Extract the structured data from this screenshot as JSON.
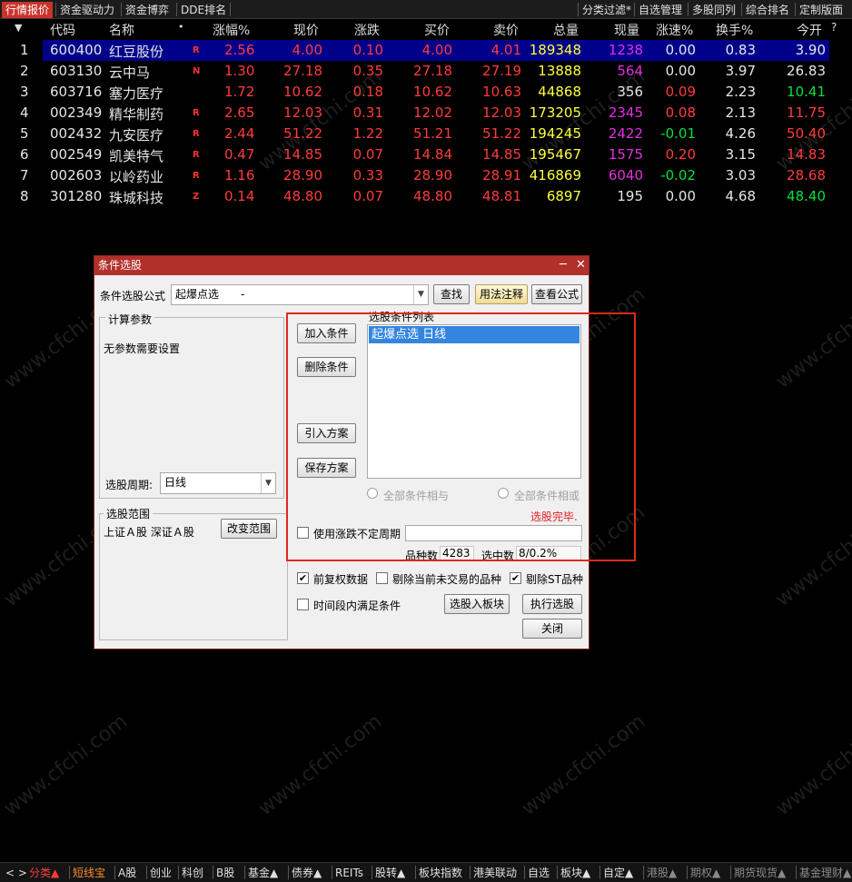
{
  "top_tabs_left": [
    "行情报价",
    "资金驱动力",
    "资金博弈",
    "DDE排名"
  ],
  "top_tabs_right": [
    "分类过滤*",
    "自选管理",
    "多股同列",
    "综合排名",
    "定制版面"
  ],
  "columns": [
    "代码",
    "名称",
    "涨幅%",
    "现价",
    "涨跌",
    "买价",
    "卖价",
    "总量",
    "现量",
    "涨速%",
    "换手%",
    "今开"
  ],
  "header_question": "?",
  "rows": [
    {
      "idx": "1",
      "code": "600400",
      "name": "红豆股份",
      "flag": "R",
      "pct": "2.56",
      "price": "4.00",
      "chg": "0.10",
      "bid": "4.00",
      "ask": "4.01",
      "vol": "189348",
      "cur": "1238",
      "speed": "0.00",
      "turn": "0.83",
      "open": "3.90"
    },
    {
      "idx": "2",
      "code": "603130",
      "name": "云中马",
      "flag": "N",
      "pct": "1.30",
      "price": "27.18",
      "chg": "0.35",
      "bid": "27.18",
      "ask": "27.19",
      "vol": "13888",
      "cur": "564",
      "speed": "0.00",
      "turn": "3.97",
      "open": "26.83"
    },
    {
      "idx": "3",
      "code": "603716",
      "name": "塞力医疗",
      "flag": "",
      "pct": "1.72",
      "price": "10.62",
      "chg": "0.18",
      "bid": "10.62",
      "ask": "10.63",
      "vol": "44868",
      "cur": "356",
      "speed": "0.09",
      "turn": "2.23",
      "open": "10.41"
    },
    {
      "idx": "4",
      "code": "002349",
      "name": "精华制药",
      "flag": "R",
      "pct": "2.65",
      "price": "12.03",
      "chg": "0.31",
      "bid": "12.02",
      "ask": "12.03",
      "vol": "173205",
      "cur": "2345",
      "speed": "0.08",
      "turn": "2.13",
      "open": "11.75"
    },
    {
      "idx": "5",
      "code": "002432",
      "name": "九安医疗",
      "flag": "R",
      "pct": "2.44",
      "price": "51.22",
      "chg": "1.22",
      "bid": "51.21",
      "ask": "51.22",
      "vol": "194245",
      "cur": "2422",
      "speed": "-0.01",
      "turn": "4.26",
      "open": "50.40"
    },
    {
      "idx": "6",
      "code": "002549",
      "name": "凯美特气",
      "flag": "R",
      "pct": "0.47",
      "price": "14.85",
      "chg": "0.07",
      "bid": "14.84",
      "ask": "14.85",
      "vol": "195467",
      "cur": "1575",
      "speed": "0.20",
      "turn": "3.15",
      "open": "14.83"
    },
    {
      "idx": "7",
      "code": "002603",
      "name": "以岭药业",
      "flag": "R",
      "pct": "1.16",
      "price": "28.90",
      "chg": "0.33",
      "bid": "28.90",
      "ask": "28.91",
      "vol": "416869",
      "cur": "6040",
      "speed": "-0.02",
      "turn": "3.03",
      "open": "28.68"
    },
    {
      "idx": "8",
      "code": "301280",
      "name": "珠城科技",
      "flag": "Z",
      "pct": "0.14",
      "price": "48.80",
      "chg": "0.07",
      "bid": "48.80",
      "ask": "48.81",
      "vol": "6897",
      "cur": "195",
      "speed": "0.00",
      "turn": "4.68",
      "open": "48.40"
    }
  ],
  "row_colors": [
    {
      "pct": "r",
      "price": "r",
      "chg": "r",
      "bid": "r",
      "ask": "r",
      "cur": "m",
      "speed": "w",
      "open": "w"
    },
    {
      "pct": "r",
      "price": "r",
      "chg": "r",
      "bid": "r",
      "ask": "r",
      "cur": "m",
      "speed": "w",
      "open": "w"
    },
    {
      "pct": "r",
      "price": "r",
      "chg": "r",
      "bid": "r",
      "ask": "r",
      "cur": "w",
      "speed": "r",
      "open": "g"
    },
    {
      "pct": "r",
      "price": "r",
      "chg": "r",
      "bid": "r",
      "ask": "r",
      "cur": "m",
      "speed": "r",
      "open": "r"
    },
    {
      "pct": "r",
      "price": "r",
      "chg": "r",
      "bid": "r",
      "ask": "r",
      "cur": "m",
      "speed": "g",
      "open": "r"
    },
    {
      "pct": "r",
      "price": "r",
      "chg": "r",
      "bid": "r",
      "ask": "r",
      "cur": "m",
      "speed": "r",
      "open": "r"
    },
    {
      "pct": "r",
      "price": "r",
      "chg": "r",
      "bid": "r",
      "ask": "r",
      "cur": "m",
      "speed": "g",
      "open": "r"
    },
    {
      "pct": "r",
      "price": "r",
      "chg": "r",
      "bid": "r",
      "ask": "r",
      "cur": "w",
      "speed": "w",
      "open": "g"
    }
  ],
  "dialog": {
    "title": "条件选股",
    "formula_label": "条件选股公式",
    "formula_value": "起爆点选　　-",
    "find_button": "查找",
    "usage_button": "用法注释",
    "view_formula_button": "查看公式",
    "params_group": "计算参数",
    "params_text": "无参数需要设置",
    "period_label": "选股周期:",
    "period_value": "日线",
    "scope_group": "选股范围",
    "scope_text": "上证Ａ股 深证Ａ股",
    "change_scope_button": "改变范围",
    "add_condition_button": "加入条件",
    "delete_condition_button": "删除条件",
    "import_plan_button": "引入方案",
    "save_plan_button": "保存方案",
    "condition_list_label": "选股条件列表",
    "condition_item": "起爆点选  日线",
    "and_all_label": "全部条件相与",
    "or_all_label": "全部条件相或",
    "status_text": "选股完毕.",
    "use_period_label": "使用涨跌不定周期",
    "count_label": "品种数",
    "count_value": "4283",
    "hit_label": "选中数",
    "hit_value": "8/0.2%",
    "pre_adjust_label": "前复权数据",
    "exclude_untraded_label": "剔除当前未交易的品种",
    "exclude_st_label": "剔除ST品种",
    "time_range_label": "时间段内满足条件",
    "to_block_button": "选股入板块",
    "execute_button": "执行选股",
    "close_button": "关闭"
  },
  "bottom_tabs": [
    {
      "label": "分类▲",
      "style": "red"
    },
    {
      "label": "短线宝",
      "style": "orange"
    },
    {
      "label": "A股",
      "style": ""
    },
    {
      "label": "创业",
      "style": ""
    },
    {
      "label": "科创",
      "style": ""
    },
    {
      "label": "B股",
      "style": ""
    },
    {
      "label": "基金▲",
      "style": ""
    },
    {
      "label": "债券▲",
      "style": ""
    },
    {
      "label": "REITs",
      "style": ""
    },
    {
      "label": "股转▲",
      "style": ""
    },
    {
      "label": "板块指数",
      "style": ""
    },
    {
      "label": "港美联动",
      "style": ""
    },
    {
      "label": "自选",
      "style": ""
    },
    {
      "label": "板块▲",
      "style": ""
    },
    {
      "label": "自定▲",
      "style": ""
    },
    {
      "label": "港股▲",
      "style": "grey"
    },
    {
      "label": "期权▲",
      "style": "grey"
    },
    {
      "label": "期货现货▲",
      "style": "grey"
    },
    {
      "label": "基金理财▲",
      "style": "grey"
    }
  ],
  "watermark": "www.cfchi.com"
}
